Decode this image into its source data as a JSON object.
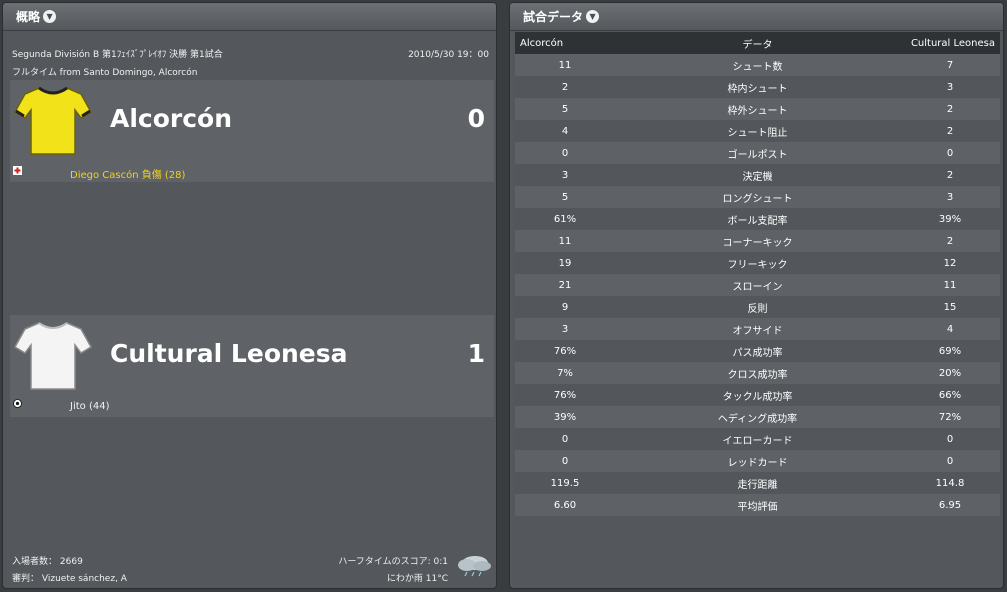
{
  "summary": {
    "title": "概略",
    "competition": "Segunda División B 第1ﾌｪｲｽﾞﾌﾟﾚｲｵﾌ 決勝 第1試合",
    "datetime": "2010/5/30 19：00",
    "status_venue": "フルタイム from Santo Domingo, Alcorcón",
    "home": {
      "name": "Alcorcón",
      "score": "0",
      "event": "Diego Cascón 負傷 (28)",
      "shirt_color": "#f2e21a"
    },
    "away": {
      "name": "Cultural Leonesa",
      "score": "1",
      "event": "Jito (44)",
      "shirt_color": "#f2f2f2"
    },
    "attendance_label": "入場者数：",
    "attendance": "2669",
    "referee_label": "審判：",
    "referee": "Vizuete sánchez, A",
    "halftime": "ハーフタイムのスコア: 0:1",
    "weather": "にわか雨 11°C",
    "event_colors": {
      "injury": "#cc2222",
      "goal": "#111111",
      "scorer_home": "#f2d21a",
      "scorer_away": "#f0f0f0"
    }
  },
  "stats": {
    "title": "試合データ",
    "header": {
      "home": "Alcorcón",
      "label": "データ",
      "away": "Cultural Leonesa"
    },
    "rows": [
      {
        "home": "11",
        "label": "シュート数",
        "away": "7"
      },
      {
        "home": "2",
        "label": "枠内シュート",
        "away": "3"
      },
      {
        "home": "5",
        "label": "枠外シュート",
        "away": "2"
      },
      {
        "home": "4",
        "label": "シュート阻止",
        "away": "2"
      },
      {
        "home": "0",
        "label": "ゴールポスト",
        "away": "0"
      },
      {
        "home": "3",
        "label": "決定機",
        "away": "2"
      },
      {
        "home": "5",
        "label": "ロングシュート",
        "away": "3"
      },
      {
        "home": "61%",
        "label": "ボール支配率",
        "away": "39%"
      },
      {
        "home": "11",
        "label": "コーナーキック",
        "away": "2"
      },
      {
        "home": "19",
        "label": "フリーキック",
        "away": "12"
      },
      {
        "home": "21",
        "label": "スローイン",
        "away": "11"
      },
      {
        "home": "9",
        "label": "反則",
        "away": "15"
      },
      {
        "home": "3",
        "label": "オフサイド",
        "away": "4"
      },
      {
        "home": "76%",
        "label": "パス成功率",
        "away": "69%"
      },
      {
        "home": "7%",
        "label": "クロス成功率",
        "away": "20%"
      },
      {
        "home": "76%",
        "label": "タックル成功率",
        "away": "66%"
      },
      {
        "home": "39%",
        "label": "ヘディング成功率",
        "away": "72%"
      },
      {
        "home": "0",
        "label": "イエローカード",
        "away": "0"
      },
      {
        "home": "0",
        "label": "レッドカード",
        "away": "0"
      },
      {
        "home": "119.5",
        "label": "走行距離",
        "away": "114.8"
      },
      {
        "home": "6.60",
        "label": "平均評価",
        "away": "6.95"
      }
    ]
  }
}
